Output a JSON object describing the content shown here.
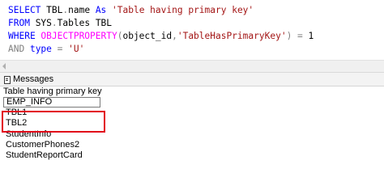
{
  "editor": {
    "lines": [
      [
        {
          "t": "SELECT ",
          "c": "kw"
        },
        {
          "t": "TBL",
          "c": "id"
        },
        {
          "t": ".",
          "c": "op"
        },
        {
          "t": "name ",
          "c": "id"
        },
        {
          "t": "As ",
          "c": "kw"
        },
        {
          "t": "'Table having primary key'",
          "c": "str"
        }
      ],
      [
        {
          "t": "FROM ",
          "c": "kw"
        },
        {
          "t": "SYS",
          "c": "id"
        },
        {
          "t": ".",
          "c": "op"
        },
        {
          "t": "Tables ",
          "c": "id"
        },
        {
          "t": "TBL",
          "c": "id"
        }
      ],
      [
        {
          "t": "WHERE ",
          "c": "kw"
        },
        {
          "t": "OBJECTPROPERTY",
          "c": "fn"
        },
        {
          "t": "(",
          "c": "op"
        },
        {
          "t": "object_id",
          "c": "id"
        },
        {
          "t": ",",
          "c": "op"
        },
        {
          "t": "'TableHasPrimaryKey'",
          "c": "str"
        },
        {
          "t": ") ",
          "c": "op"
        },
        {
          "t": "= ",
          "c": "op"
        },
        {
          "t": "1",
          "c": "id"
        }
      ],
      [
        {
          "t": "AND ",
          "c": "op"
        },
        {
          "t": "type ",
          "c": "kw"
        },
        {
          "t": "= ",
          "c": "op"
        },
        {
          "t": "'U'",
          "c": "str"
        }
      ]
    ]
  },
  "tabs": {
    "messages_label": "Messages"
  },
  "results": {
    "column_header": "Table having primary key",
    "rows": [
      "EMP_INFO",
      "TBL1",
      "TBL2",
      "StudentInfo",
      "CustomerPhones2",
      "StudentReportCard"
    ]
  },
  "colors": {
    "keyword": "#0000ff",
    "string": "#a31515",
    "function": "#ff00ff",
    "operator": "#808080",
    "highlight": "#e2001a"
  }
}
